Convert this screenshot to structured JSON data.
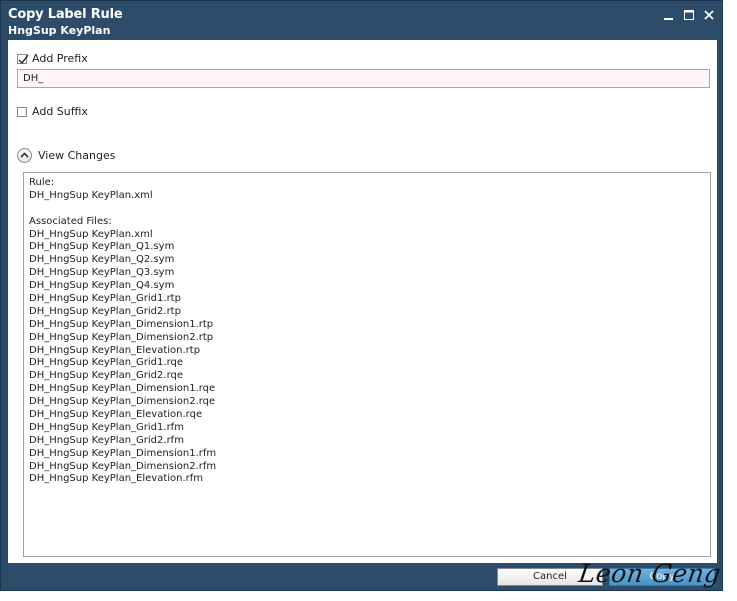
{
  "window": {
    "title": "Copy Label Rule",
    "subtitle": "HngSup KeyPlan"
  },
  "prefix": {
    "label": "Add Prefix",
    "checked": true,
    "value": "DH_"
  },
  "suffix": {
    "label": "Add Suffix",
    "checked": false
  },
  "view_changes": {
    "label": "View Changes",
    "lines": [
      "Rule:",
      "DH_HngSup KeyPlan.xml",
      "",
      "Associated Files:",
      "DH_HngSup KeyPlan.xml",
      "DH_HngSup KeyPlan_Q1.sym",
      "DH_HngSup KeyPlan_Q2.sym",
      "DH_HngSup KeyPlan_Q3.sym",
      "DH_HngSup KeyPlan_Q4.sym",
      "DH_HngSup KeyPlan_Grid1.rtp",
      "DH_HngSup KeyPlan_Grid2.rtp",
      "DH_HngSup KeyPlan_Dimension1.rtp",
      "DH_HngSup KeyPlan_Dimension2.rtp",
      "DH_HngSup KeyPlan_Elevation.rtp",
      "DH_HngSup KeyPlan_Grid1.rqe",
      "DH_HngSup KeyPlan_Grid2.rqe",
      "DH_HngSup KeyPlan_Dimension1.rqe",
      "DH_HngSup KeyPlan_Dimension2.rqe",
      "DH_HngSup KeyPlan_Elevation.rqe",
      "DH_HngSup KeyPlan_Grid1.rfm",
      "DH_HngSup KeyPlan_Grid2.rfm",
      "DH_HngSup KeyPlan_Dimension1.rfm",
      "DH_HngSup KeyPlan_Dimension2.rfm",
      "DH_HngSup KeyPlan_Elevation.rfm"
    ]
  },
  "buttons": {
    "cancel": "Cancel",
    "copy": "Copy"
  },
  "watermark": "Leon Geng",
  "icons": {
    "minimize": "minimize-icon",
    "maximize": "maximize-icon",
    "close": "close-icon",
    "checkmark": "checkmark-icon",
    "expander": "chevron-up-icon"
  },
  "colors": {
    "frame": "#2d4c69",
    "input_bg": "#fdf5fa",
    "copy_button": "#4a93c6"
  }
}
